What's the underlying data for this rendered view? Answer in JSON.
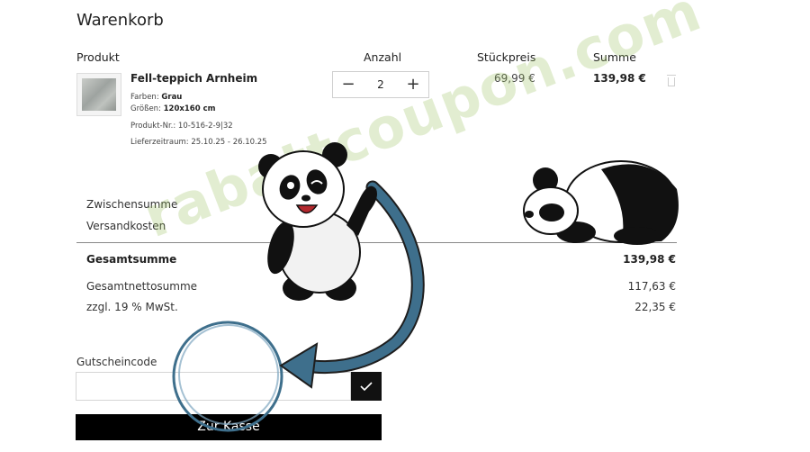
{
  "page": {
    "title": "Warenkorb"
  },
  "table": {
    "headers": {
      "product": "Produkt",
      "quantity": "Anzahl",
      "unit_price": "Stückpreis",
      "sum": "Summe"
    }
  },
  "item": {
    "name": "Fell-teppich Arnheim",
    "color_label": "Farben:",
    "color_value": "Grau",
    "size_label": "Größen:",
    "size_value": "120x160 cm",
    "product_number": "Produkt-Nr.: 10-516-2-9|32",
    "delivery": "Lieferzeitraum: 25.10.25 - 26.10.25",
    "quantity": "2",
    "minus": "−",
    "plus": "+",
    "unit_price": "69,99 €",
    "sum": "139,98 €",
    "icon": "trash-icon"
  },
  "summary": {
    "subtotal_label": "Zwischensumme",
    "shipping_label": "Versandkosten",
    "total_label": "Gesamtsumme",
    "total_value": "139,98 €",
    "net_label": "Gesamtnettosumme",
    "net_value": "117,63 €",
    "vat_label": "zzgl. 19 % MwSt.",
    "vat_value": "22,35 €"
  },
  "coupon": {
    "label": "Gutscheincode",
    "value": "",
    "placeholder": "",
    "submit_icon": "check-icon"
  },
  "checkout": {
    "label": "Zur Kasse"
  },
  "overlay": {
    "watermark": "rabattcoupon.com",
    "panda_colors": {
      "black": "#111111",
      "white": "#ffffff",
      "gray": "#e4e4e4"
    },
    "arrow_color": "#3e6f8c",
    "icons": [
      "panda-waving-icon",
      "panda-sleeping-icon",
      "curved-arrow-icon",
      "highlight-circle-icon"
    ]
  }
}
